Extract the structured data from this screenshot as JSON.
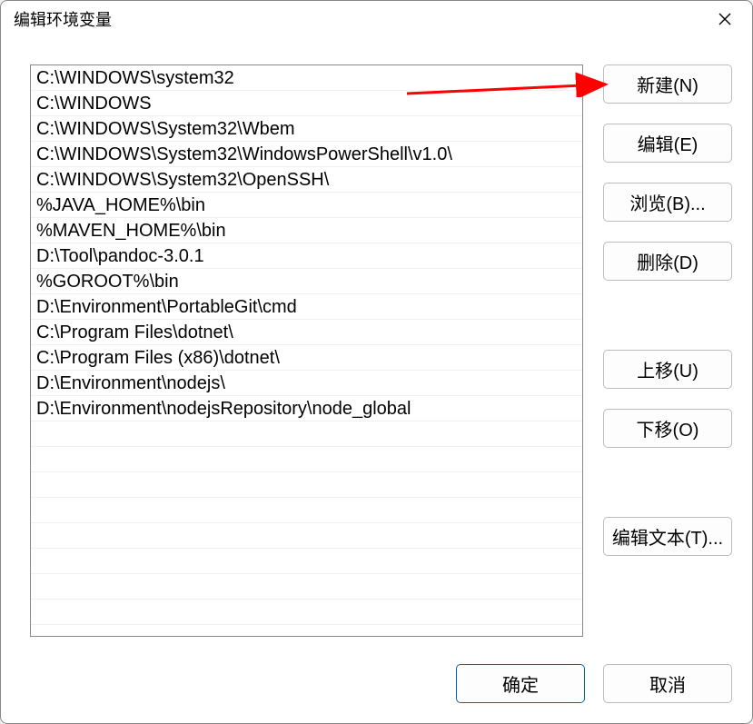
{
  "dialog": {
    "title": "编辑环境变量"
  },
  "paths": [
    "C:\\WINDOWS\\system32",
    "C:\\WINDOWS",
    "C:\\WINDOWS\\System32\\Wbem",
    "C:\\WINDOWS\\System32\\WindowsPowerShell\\v1.0\\",
    "C:\\WINDOWS\\System32\\OpenSSH\\",
    "%JAVA_HOME%\\bin",
    "%MAVEN_HOME%\\bin",
    "D:\\Tool\\pandoc-3.0.1",
    "%GOROOT%\\bin",
    "D:\\Environment\\PortableGit\\cmd",
    "C:\\Program Files\\dotnet\\",
    "C:\\Program Files (x86)\\dotnet\\",
    "D:\\Environment\\nodejs\\",
    "D:\\Environment\\nodejsRepository\\node_global"
  ],
  "buttons": {
    "new": "新建(N)",
    "edit": "编辑(E)",
    "browse": "浏览(B)...",
    "delete": "删除(D)",
    "moveup": "上移(U)",
    "movedown": "下移(O)",
    "edittext": "编辑文本(T)...",
    "ok": "确定",
    "cancel": "取消"
  }
}
